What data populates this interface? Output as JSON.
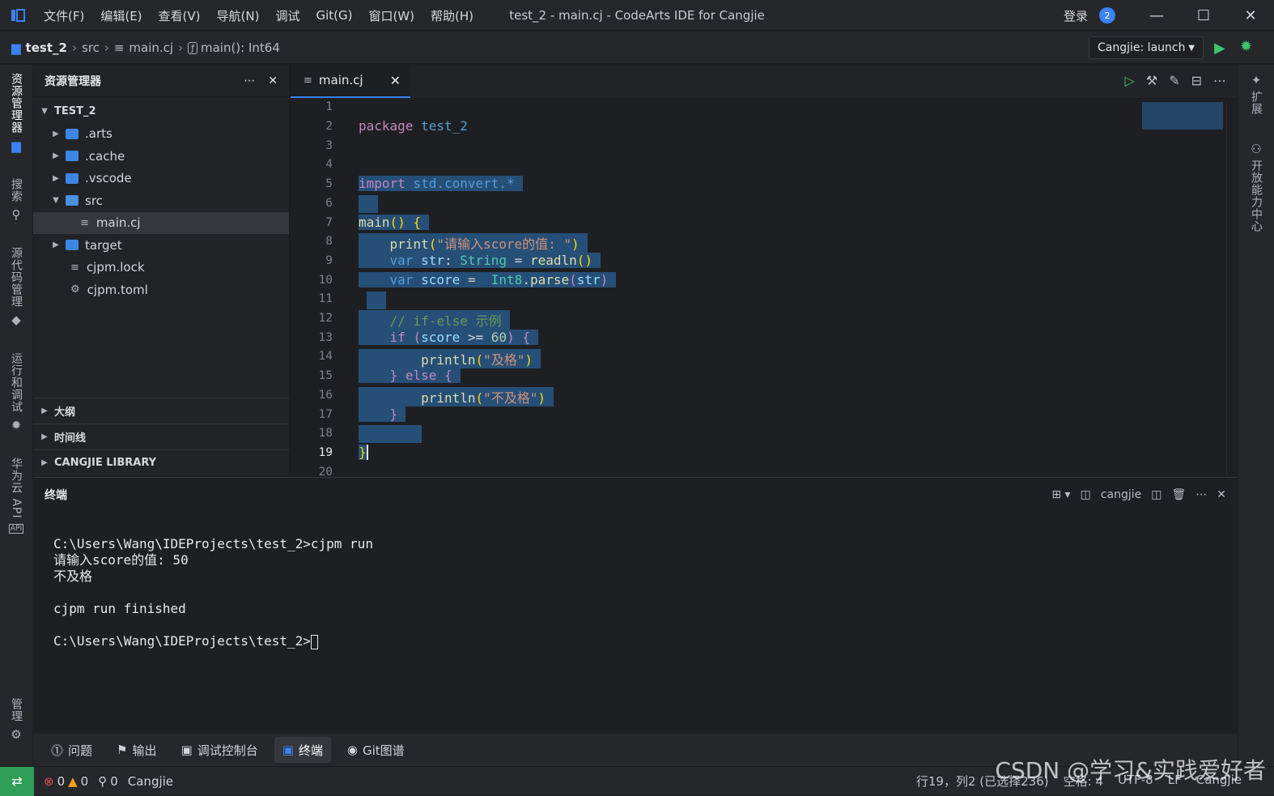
{
  "titlebar": {
    "menu": [
      "文件(F)",
      "编辑(E)",
      "查看(V)",
      "导航(N)",
      "调试",
      "Git(G)",
      "窗口(W)",
      "帮助(H)"
    ],
    "title": "test_2 - main.cj - CodeArts IDE for Cangjie",
    "login": "登录",
    "notifications": "2"
  },
  "breadcrumb": {
    "project": "test_2",
    "folder": "src",
    "file": "main.cj",
    "symbol": "main(): Int64"
  },
  "run_config": {
    "label": "Cangjie: launch"
  },
  "activity_bar": {
    "explorer": "资源管理器",
    "search": "搜索",
    "scm": "源代码管理",
    "run_debug": "运行和调试",
    "cloud_api": "华为云 API",
    "manage": "管理"
  },
  "right_bar": {
    "extensions": "扩展",
    "open_capability": "开放能力中心"
  },
  "sidebar": {
    "title": "资源管理器",
    "root": "TEST_2",
    "items": [
      ".arts",
      ".cache",
      ".vscode",
      "src",
      "main.cj",
      "target",
      "cjpm.lock",
      "cjpm.toml"
    ],
    "panels": [
      "大纲",
      "时间线",
      "CANGJIE LIBRARY"
    ]
  },
  "editor": {
    "tab": "main.cj",
    "line_numbers": [
      "1",
      "2",
      "3",
      "4",
      "5",
      "6",
      "7",
      "8",
      "9",
      "10",
      "11",
      "12",
      "13",
      "14",
      "15",
      "16",
      "17",
      "18",
      "19",
      "20"
    ],
    "code": {
      "l2_kw": "package",
      "l2_name": "test_2",
      "l5_kw": "import",
      "l5_mod": "std.convert.*",
      "l7_fn": "main",
      "l7_rest": "() {",
      "l8_fn": "print",
      "l8_str": "\"请输入score的值: \"",
      "l9_kw": "var",
      "l9_name": "str",
      "l9_type": "String",
      "l9_fn": "readln",
      "l10_kw": "var",
      "l10_name": "score",
      "l10_type": "Int8",
      "l10_fn": "parse",
      "l10_arg": "str",
      "l12_cm": "// if-else 示例",
      "l13_kw": "if",
      "l13_name": "score",
      "l13_op": ">=",
      "l13_num": "60",
      "l14_fn": "println",
      "l14_str": "\"及格\"",
      "l15_kw": "else",
      "l16_fn": "println",
      "l16_str": "\"不及格\"",
      "l17": "}",
      "l19": "}"
    }
  },
  "terminal": {
    "title": "终端",
    "profile": "cangjie",
    "lines": [
      "C:\\Users\\Wang\\IDEProjects\\test_2>cjpm run",
      "请输入score的值: 50",
      "不及格",
      "",
      "cjpm run finished",
      "",
      "C:\\Users\\Wang\\IDEProjects\\test_2>"
    ]
  },
  "bottom_tabs": [
    "问题",
    "输出",
    "调试控制台",
    "终端",
    "Git图谱"
  ],
  "status": {
    "errors": "0",
    "warnings": "0",
    "ports": "0",
    "language_label": "Cangjie",
    "position": "行19，列2 (已选择236)",
    "spaces": "空格: 4",
    "encoding": "UTF-8",
    "eol": "LF",
    "language": "Cangjie"
  },
  "watermark": "CSDN @学习&实践爱好者",
  "colors": {
    "accent": "#3b82f6",
    "run": "#3ec46d",
    "selection": "#264f78",
    "status_remote": "#2f9e57"
  }
}
